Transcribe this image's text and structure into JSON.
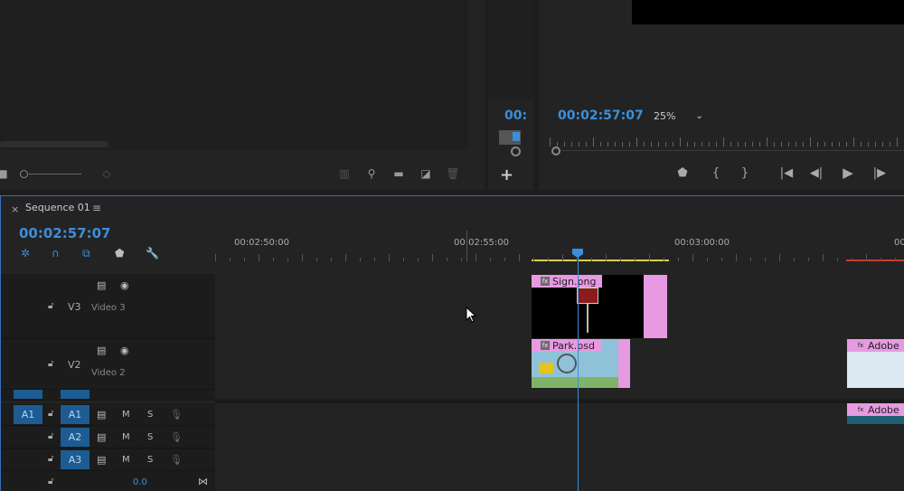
{
  "source_monitor": {
    "toolbar_icons": [
      "insert-icon",
      "zoom-slider",
      "sort-icon",
      "list-view-icon",
      "search-icon",
      "new-bin-icon",
      "new-item-icon",
      "trash-icon"
    ]
  },
  "mid_panel": {
    "timecode": "00:",
    "add_label": "+"
  },
  "program_monitor": {
    "timecode": "00:02:57:07",
    "zoom_value": "25%",
    "zoom_caret": "⌄",
    "transport": {
      "marker": "⬟",
      "in_point": "{",
      "out_point": "}",
      "go_to_in": "|◀",
      "step_back": "◀|",
      "play": "▶",
      "step_forward": "|▶"
    }
  },
  "timeline": {
    "tab_close": "×",
    "sequence_name": "Sequence 01",
    "tab_menu": "≡",
    "timecode": "00:02:57:07",
    "ruler_labels": [
      "00:02:50:00",
      "00:02:55:00",
      "00:03:00:00",
      "00"
    ],
    "tracks": {
      "v3": {
        "label": "V3",
        "name": "Video 3"
      },
      "v2": {
        "label": "V2",
        "name": "Video 2"
      },
      "a1_source": "A1",
      "a1": {
        "label": "A1",
        "m": "M",
        "s": "S"
      },
      "a2": {
        "label": "A2",
        "m": "M",
        "s": "S"
      },
      "a3": {
        "label": "A3",
        "m": "M",
        "s": "S"
      },
      "master_value": "0.0"
    },
    "clips": {
      "sign": "Sign.png",
      "park": "Park.psd",
      "adobe_v2": "Adobe",
      "adobe_a": "Adobe",
      "fx": "fx"
    },
    "colors": {
      "accent_blue": "#3b8fd9",
      "clip_pink": "#e79ae1",
      "work_area_yellow": "#d6cf50",
      "render_red": "#c93c2d"
    }
  }
}
